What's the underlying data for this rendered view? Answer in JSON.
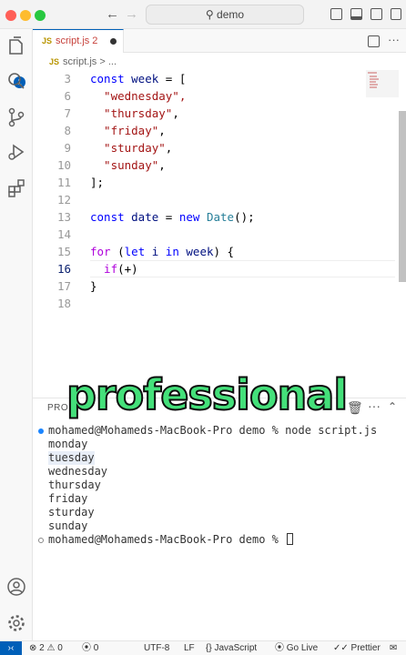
{
  "window": {
    "search_text": "demo",
    "back_icon": "arrow-left-icon",
    "forward_icon": "arrow-right-icon"
  },
  "activity_bar": {
    "explorer_badge": "1"
  },
  "tabs": [
    {
      "icon_text": "JS",
      "label": "script.js",
      "problems": "2",
      "modified": true
    }
  ],
  "breadcrumbs": {
    "file": "script.js",
    "separator": ">",
    "more": "..."
  },
  "editor": {
    "lines": [
      {
        "n": "3",
        "tokens": [
          {
            "t": "const ",
            "c": "kw"
          },
          {
            "t": "week",
            "c": "var"
          },
          {
            "t": " = [",
            "c": "txt"
          }
        ]
      },
      {
        "n": "6",
        "tokens": [
          {
            "t": "  \"wednesday\",",
            "c": "str"
          }
        ]
      },
      {
        "n": "7",
        "tokens": [
          {
            "t": "  \"thursday\"",
            "c": "str"
          },
          {
            "t": ",",
            "c": "txt"
          }
        ]
      },
      {
        "n": "8",
        "tokens": [
          {
            "t": "  \"friday\"",
            "c": "str"
          },
          {
            "t": ",",
            "c": "txt"
          }
        ]
      },
      {
        "n": "9",
        "tokens": [
          {
            "t": "  \"sturday\"",
            "c": "str"
          },
          {
            "t": ",",
            "c": "txt"
          }
        ]
      },
      {
        "n": "10",
        "tokens": [
          {
            "t": "  \"sunday\"",
            "c": "str"
          },
          {
            "t": ",",
            "c": "txt"
          }
        ]
      },
      {
        "n": "11",
        "tokens": [
          {
            "t": "];",
            "c": "txt"
          }
        ]
      },
      {
        "n": "12",
        "tokens": []
      },
      {
        "n": "13",
        "tokens": [
          {
            "t": "const ",
            "c": "kw"
          },
          {
            "t": "date",
            "c": "var"
          },
          {
            "t": " = ",
            "c": "txt"
          },
          {
            "t": "new ",
            "c": "kw"
          },
          {
            "t": "Date",
            "c": "cls"
          },
          {
            "t": "();",
            "c": "txt"
          }
        ]
      },
      {
        "n": "14",
        "tokens": []
      },
      {
        "n": "15",
        "tokens": [
          {
            "t": "for",
            "c": "kw2"
          },
          {
            "t": " (",
            "c": "txt"
          },
          {
            "t": "let ",
            "c": "kw"
          },
          {
            "t": "i",
            "c": "var"
          },
          {
            "t": " in ",
            "c": "kw"
          },
          {
            "t": "week",
            "c": "var"
          },
          {
            "t": ") {",
            "c": "txt"
          }
        ]
      },
      {
        "n": "16",
        "tokens": [
          {
            "t": "  if",
            "c": "kw2"
          },
          {
            "t": "(+)",
            "c": "txt"
          }
        ],
        "active": true
      },
      {
        "n": "17",
        "tokens": [
          {
            "t": "}",
            "c": "txt"
          }
        ]
      },
      {
        "n": "18",
        "tokens": []
      }
    ]
  },
  "panel": {
    "tab_problems": "PRO",
    "trash_icon": "trash-icon",
    "chevron_icon": "chevron-up-icon"
  },
  "terminal": {
    "lines": [
      "mohamed@Mohameds-MacBook-Pro demo % node script.js",
      "monday",
      "tuesday",
      "wednesday",
      "thursday",
      "friday",
      "sturday",
      "sunday"
    ],
    "prompt": "mohamed@Mohameds-MacBook-Pro demo % "
  },
  "overlay_caption": "professional",
  "status_bar": {
    "errors": "2",
    "warnings": "0",
    "ports": "0",
    "encoding": "UTF-8",
    "eol": "LF",
    "language_braces": "{}",
    "language": "JavaScript",
    "go_live": "Go Live",
    "prettier": "Prettier"
  }
}
